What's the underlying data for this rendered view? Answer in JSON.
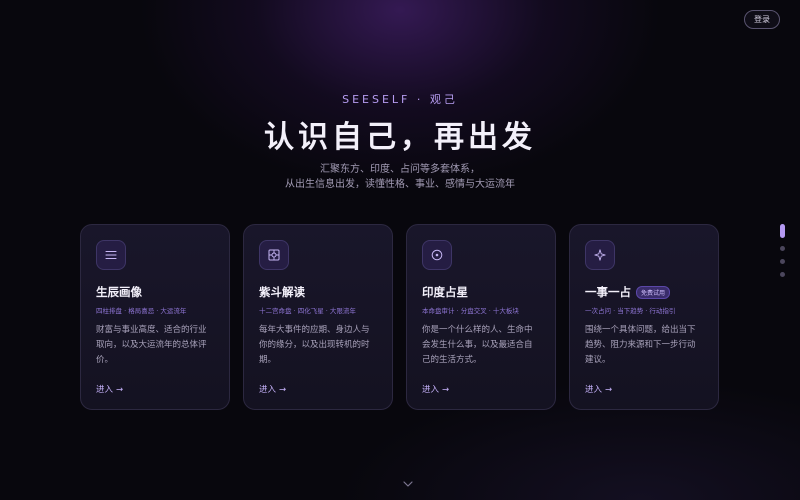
{
  "header": {
    "login_label": "登录"
  },
  "hero": {
    "eyebrow": "SEESELF · 观己",
    "title": "认识自己，再出发",
    "subtitle_line1": "汇聚东方、印度、占问等多套体系，",
    "subtitle_line2": "从出生信息出发，读懂性格、事业、感情与大运流年"
  },
  "cards": [
    {
      "icon": "list-icon",
      "title": "生辰画像",
      "badge": "",
      "tags": "四柱排盘 · 格局喜忌 · 大运流年",
      "description": "财富与事业高度、适合的行业取向，以及大运流年的总体评价。",
      "enter_label": "进入"
    },
    {
      "icon": "grid-star-icon",
      "title": "紫斗解读",
      "badge": "",
      "tags": "十二宫命盘 · 四化飞星 · 大限流年",
      "description": "每年大事件的应期、身边人与你的缘分，以及出现转机的时期。",
      "enter_label": "进入"
    },
    {
      "icon": "target-icon",
      "title": "印度占星",
      "badge": "",
      "tags": "本命盘审计 · 分盘交叉 · 十大板块",
      "description": "你是一个什么样的人、生命中会发生什么事，以及最适合自己的生活方式。",
      "enter_label": "进入"
    },
    {
      "icon": "sparkle-icon",
      "title": "一事一占",
      "badge": "免费试用",
      "tags": "一次占问 · 当下趋势 · 行动指引",
      "description": "围绕一个具体问题，给出当下趋势、阻力来源和下一步行动建议。",
      "enter_label": "进入"
    }
  ],
  "pagination": {
    "total": 4,
    "active_index": 0
  },
  "colors": {
    "accent": "#b59af2",
    "background": "#08070d",
    "card": "#17142a"
  }
}
